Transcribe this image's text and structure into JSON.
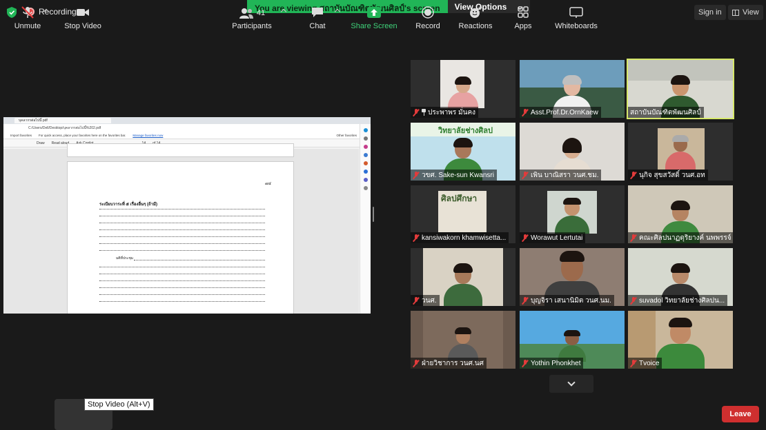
{
  "top": {
    "recording_label": "Recording",
    "viewing_text": "You are viewing สถาบันบัณฑิตพัฒนศิลป์'s screen",
    "view_options_label": "View Options",
    "sign_in_label": "Sign in",
    "view_label": "View"
  },
  "shared_screen": {
    "tab_title": "บุคลากรต่อไปนี้ pdf",
    "url": "C:/Users/Dell/Desktop/บุคลากรต่อไปนี้%202.pdf",
    "fav_hint": "For quick access, place your favorites here on the favorites bar.",
    "fav_link": "Manage favorites now",
    "import_label": "Import favorites",
    "other_fav": "Other favorites",
    "draw_label": "Draw",
    "read_aloud_label": "Read aloud",
    "ask_copilot_label": "Ask Copilot",
    "page_current": "14",
    "page_total": "of 14",
    "page_number": "๗๔",
    "page_heading": "ระเบียบวาระที่ ๕ เรื่องอื่นๆ (ถ้ามี)",
    "signature_text": "มติที่ประชุม",
    "accent_color": "#1a5cc8"
  },
  "participants": [
    {
      "name": "ประพาพร มั่นคง",
      "pinned": true,
      "active": false
    },
    {
      "name": "Asst.Prof.Dr.OrnKaew",
      "pinned": false,
      "active": false
    },
    {
      "name": "สถาบันบัณฑิตพัฒนศิลป์",
      "pinned": false,
      "active": true
    },
    {
      "name": "วขศ. Sake-sun Kwansri",
      "pinned": false,
      "active": false
    },
    {
      "name": "เพิน บาณิสรา วนศ.ชม.",
      "pinned": false,
      "active": false
    },
    {
      "name": "นุกิจ สุขสวัสดิ์ วนศ.อท",
      "pinned": false,
      "active": false
    },
    {
      "name": "kansiwakorn khamwisetta...",
      "pinned": false,
      "active": false
    },
    {
      "name": "Worawut Lertutai",
      "pinned": false,
      "active": false
    },
    {
      "name": "คณะศิลปนาฏดุริยางค์ นพพรรจ์",
      "pinned": false,
      "active": false
    },
    {
      "name": "วนศ.",
      "pinned": false,
      "active": false
    },
    {
      "name": "บุญจิรา เสนานิมิต วนศ.นม.",
      "pinned": false,
      "active": false
    },
    {
      "name": "suvadol   วิทยาลัยช่างศิลปน...",
      "pinned": false,
      "active": false
    },
    {
      "name": "ฝ่ายวิชาการ วนศ.นศ",
      "pinned": false,
      "active": false
    },
    {
      "name": "Yothin Phonkhet",
      "pinned": false,
      "active": false
    },
    {
      "name": "Tvoice",
      "pinned": false,
      "active": false
    }
  ],
  "tile_texts": {
    "college_banner": "วิทยาลัยช่างศิลป",
    "book_title": "ศิลปศึกษา"
  },
  "toolbar": {
    "unmute": "Unmute",
    "stop_video": "Stop Video",
    "tooltip": "Stop Video (Alt+V)",
    "participants": "Participants",
    "participants_count": "41",
    "chat": "Chat",
    "share_screen": "Share Screen",
    "record": "Record",
    "reactions": "Reactions",
    "apps": "Apps",
    "whiteboards": "Whiteboards",
    "leave": "Leave",
    "share_color": "#21b557",
    "leave_color": "#cf2f2f"
  }
}
